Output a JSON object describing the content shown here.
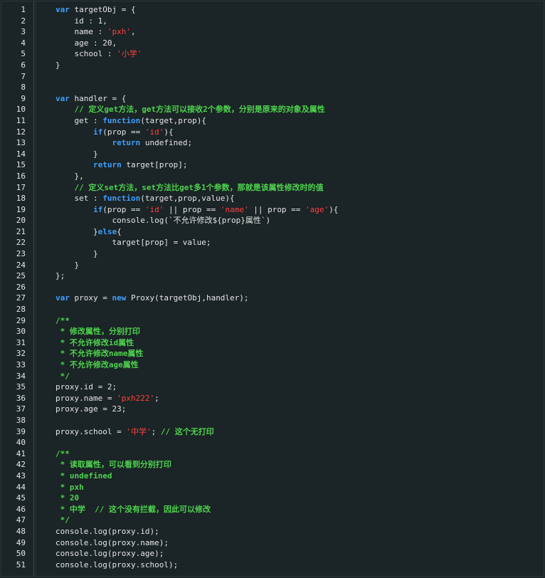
{
  "editor": {
    "lines": [
      {
        "n": "1",
        "tokens": [
          {
            "t": "",
            "c": "plain"
          },
          {
            "t": "var",
            "c": "kw"
          },
          {
            "t": " targetObj = {",
            "c": "plain"
          }
        ]
      },
      {
        "n": "2",
        "tokens": [
          {
            "t": "    id : 1,",
            "c": "plain"
          }
        ]
      },
      {
        "n": "3",
        "tokens": [
          {
            "t": "    name : ",
            "c": "plain"
          },
          {
            "t": "'pxh'",
            "c": "str"
          },
          {
            "t": ",",
            "c": "plain"
          }
        ]
      },
      {
        "n": "4",
        "tokens": [
          {
            "t": "    age : 20,",
            "c": "plain"
          }
        ]
      },
      {
        "n": "5",
        "tokens": [
          {
            "t": "    school : ",
            "c": "plain"
          },
          {
            "t": "'小学'",
            "c": "str"
          }
        ]
      },
      {
        "n": "6",
        "tokens": [
          {
            "t": "}",
            "c": "plain"
          }
        ]
      },
      {
        "n": "7",
        "tokens": []
      },
      {
        "n": "8",
        "tokens": []
      },
      {
        "n": "9",
        "tokens": [
          {
            "t": "var",
            "c": "kw"
          },
          {
            "t": " handler = {",
            "c": "plain"
          }
        ]
      },
      {
        "n": "10",
        "tokens": [
          {
            "t": "    ",
            "c": "plain"
          },
          {
            "t": "// 定义get方法，get方法可以接收2个参数，分别是原来的对象及属性",
            "c": "cmt"
          }
        ]
      },
      {
        "n": "11",
        "tokens": [
          {
            "t": "    get : ",
            "c": "plain"
          },
          {
            "t": "function",
            "c": "kw"
          },
          {
            "t": "(target,prop){",
            "c": "plain"
          }
        ]
      },
      {
        "n": "12",
        "tokens": [
          {
            "t": "        ",
            "c": "plain"
          },
          {
            "t": "if",
            "c": "kw"
          },
          {
            "t": "(prop == ",
            "c": "plain"
          },
          {
            "t": "'id'",
            "c": "str"
          },
          {
            "t": "){",
            "c": "plain"
          }
        ]
      },
      {
        "n": "13",
        "tokens": [
          {
            "t": "            ",
            "c": "plain"
          },
          {
            "t": "return",
            "c": "kw"
          },
          {
            "t": " undefined;",
            "c": "plain"
          }
        ]
      },
      {
        "n": "14",
        "tokens": [
          {
            "t": "        }",
            "c": "plain"
          }
        ]
      },
      {
        "n": "15",
        "tokens": [
          {
            "t": "        ",
            "c": "plain"
          },
          {
            "t": "return",
            "c": "kw"
          },
          {
            "t": " target[prop];",
            "c": "plain"
          }
        ]
      },
      {
        "n": "16",
        "tokens": [
          {
            "t": "    },",
            "c": "plain"
          }
        ]
      },
      {
        "n": "17",
        "tokens": [
          {
            "t": "    ",
            "c": "plain"
          },
          {
            "t": "// 定义set方法，set方法比get多1个参数，那就是该属性修改时的值",
            "c": "cmt"
          }
        ]
      },
      {
        "n": "18",
        "tokens": [
          {
            "t": "    set : ",
            "c": "plain"
          },
          {
            "t": "function",
            "c": "kw"
          },
          {
            "t": "(target,prop,value){",
            "c": "plain"
          }
        ]
      },
      {
        "n": "19",
        "tokens": [
          {
            "t": "        ",
            "c": "plain"
          },
          {
            "t": "if",
            "c": "kw"
          },
          {
            "t": "(prop == ",
            "c": "plain"
          },
          {
            "t": "'id'",
            "c": "str"
          },
          {
            "t": " || prop == ",
            "c": "plain"
          },
          {
            "t": "'name'",
            "c": "str"
          },
          {
            "t": " || prop == ",
            "c": "plain"
          },
          {
            "t": "'age'",
            "c": "str"
          },
          {
            "t": "){",
            "c": "plain"
          }
        ]
      },
      {
        "n": "20",
        "tokens": [
          {
            "t": "            console.log(`不允许修改${prop}属性`)",
            "c": "plain"
          }
        ]
      },
      {
        "n": "21",
        "tokens": [
          {
            "t": "        }",
            "c": "plain"
          },
          {
            "t": "else",
            "c": "kw"
          },
          {
            "t": "{",
            "c": "plain"
          }
        ]
      },
      {
        "n": "22",
        "tokens": [
          {
            "t": "            target[prop] = value;",
            "c": "plain"
          }
        ]
      },
      {
        "n": "23",
        "tokens": [
          {
            "t": "        }",
            "c": "plain"
          }
        ]
      },
      {
        "n": "24",
        "tokens": [
          {
            "t": "    }",
            "c": "plain"
          }
        ]
      },
      {
        "n": "25",
        "tokens": [
          {
            "t": "};",
            "c": "plain"
          }
        ]
      },
      {
        "n": "26",
        "tokens": []
      },
      {
        "n": "27",
        "tokens": [
          {
            "t": "var",
            "c": "kw"
          },
          {
            "t": " proxy = ",
            "c": "plain"
          },
          {
            "t": "new",
            "c": "kw"
          },
          {
            "t": " Proxy(targetObj,handler);",
            "c": "plain"
          }
        ]
      },
      {
        "n": "28",
        "tokens": []
      },
      {
        "n": "29",
        "tokens": [
          {
            "t": "/**",
            "c": "cmt"
          }
        ]
      },
      {
        "n": "30",
        "tokens": [
          {
            "t": " * 修改属性，分别打印",
            "c": "cmt"
          }
        ]
      },
      {
        "n": "31",
        "tokens": [
          {
            "t": " * 不允许修改id属性",
            "c": "cmt"
          }
        ]
      },
      {
        "n": "32",
        "tokens": [
          {
            "t": " * 不允许修改name属性",
            "c": "cmt"
          }
        ]
      },
      {
        "n": "33",
        "tokens": [
          {
            "t": " * 不允许修改age属性",
            "c": "cmt"
          }
        ]
      },
      {
        "n": "34",
        "tokens": [
          {
            "t": " */",
            "c": "cmt"
          }
        ]
      },
      {
        "n": "35",
        "tokens": [
          {
            "t": "proxy.id = 2;",
            "c": "plain"
          }
        ]
      },
      {
        "n": "36",
        "tokens": [
          {
            "t": "proxy.name = ",
            "c": "plain"
          },
          {
            "t": "'pxh222'",
            "c": "str"
          },
          {
            "t": ";",
            "c": "plain"
          }
        ]
      },
      {
        "n": "37",
        "tokens": [
          {
            "t": "proxy.age = 23;",
            "c": "plain"
          }
        ]
      },
      {
        "n": "38",
        "tokens": []
      },
      {
        "n": "39",
        "tokens": [
          {
            "t": "proxy.school = ",
            "c": "plain"
          },
          {
            "t": "'中学'",
            "c": "str"
          },
          {
            "t": "; ",
            "c": "plain"
          },
          {
            "t": "// 这个无打印",
            "c": "cmt"
          }
        ]
      },
      {
        "n": "40",
        "tokens": []
      },
      {
        "n": "41",
        "tokens": [
          {
            "t": "/**",
            "c": "cmt"
          }
        ]
      },
      {
        "n": "42",
        "tokens": [
          {
            "t": " * 读取属性，可以看到分别打印",
            "c": "cmt"
          }
        ]
      },
      {
        "n": "43",
        "tokens": [
          {
            "t": " * undefined",
            "c": "cmt"
          }
        ]
      },
      {
        "n": "44",
        "tokens": [
          {
            "t": " * pxh",
            "c": "cmt"
          }
        ]
      },
      {
        "n": "45",
        "tokens": [
          {
            "t": " * 20",
            "c": "cmt"
          }
        ]
      },
      {
        "n": "46",
        "tokens": [
          {
            "t": " * 中学  // 这个没有拦截，因此可以修改",
            "c": "cmt"
          }
        ]
      },
      {
        "n": "47",
        "tokens": [
          {
            "t": " */",
            "c": "cmt"
          }
        ]
      },
      {
        "n": "48",
        "tokens": [
          {
            "t": "console.log(proxy.id);",
            "c": "plain"
          }
        ]
      },
      {
        "n": "49",
        "tokens": [
          {
            "t": "console.log(proxy.name);",
            "c": "plain"
          }
        ]
      },
      {
        "n": "50",
        "tokens": [
          {
            "t": "console.log(proxy.age);",
            "c": "plain"
          }
        ]
      },
      {
        "n": "51",
        "tokens": [
          {
            "t": "console.log(proxy.school);",
            "c": "plain"
          }
        ]
      }
    ]
  },
  "theme": {
    "background": "#1b2426",
    "keyword": "#3ea0ff",
    "string": "#ff4040",
    "comment": "#4ed34e",
    "text": "#e6e6e6"
  }
}
